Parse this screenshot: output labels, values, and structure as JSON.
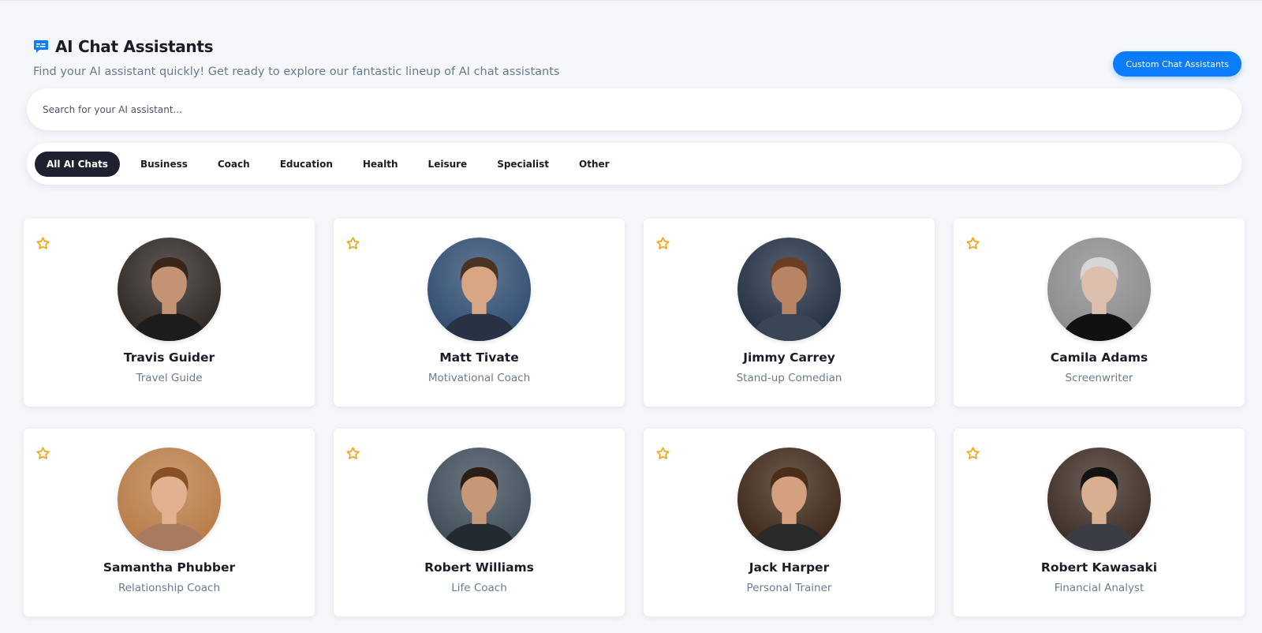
{
  "header": {
    "title": "AI Chat Assistants",
    "subtitle": "Find your AI assistant quickly! Get ready to explore our fantastic lineup of AI chat assistants",
    "icon": "chat-bubble-icon",
    "custom_button_label": "Custom Chat Assistants"
  },
  "search": {
    "placeholder": "Search for your AI assistant..."
  },
  "tabs": [
    {
      "label": "All AI Chats",
      "active": true
    },
    {
      "label": "Business",
      "active": false
    },
    {
      "label": "Coach",
      "active": false
    },
    {
      "label": "Education",
      "active": false
    },
    {
      "label": "Health",
      "active": false
    },
    {
      "label": "Leisure",
      "active": false
    },
    {
      "label": "Specialist",
      "active": false
    },
    {
      "label": "Other",
      "active": false
    }
  ],
  "assistants": [
    {
      "name": "Travis Guider",
      "role": "Travel Guide",
      "favorite": false,
      "bg": "#2a2420",
      "skin": "#c49373",
      "hair": "#3a2618",
      "shirt": "#1c1c1c"
    },
    {
      "name": "Matt Tivate",
      "role": "Motivational Coach",
      "favorite": false,
      "bg": "#2c4a6e",
      "skin": "#d7a684",
      "hair": "#4a3324",
      "shirt": "#283244"
    },
    {
      "name": "Jimmy Carrey",
      "role": "Stand-up Comedian",
      "favorite": false,
      "bg": "#1f2c40",
      "skin": "#b98464",
      "hair": "#6a3e22",
      "shirt": "#3a4656"
    },
    {
      "name": "Camila Adams",
      "role": "Screenwriter",
      "favorite": false,
      "bg": "#8a8a8a",
      "skin": "#dcc0ad",
      "hair": "#d6d6d6",
      "shirt": "#111111"
    },
    {
      "name": "Samantha Phubber",
      "role": "Relationship Coach",
      "favorite": false,
      "bg": "#b77a44",
      "skin": "#e2b190",
      "hair": "#8a4f24",
      "shirt": "#a87a5e"
    },
    {
      "name": "Robert Williams",
      "role": "Life Coach",
      "favorite": false,
      "bg": "#3c4a56",
      "skin": "#c79878",
      "hair": "#2a1e16",
      "shirt": "#232a31"
    },
    {
      "name": "Jack Harper",
      "role": "Personal Trainer",
      "favorite": false,
      "bg": "#3a2414",
      "skin": "#d4a07e",
      "hair": "#4a2e1a",
      "shirt": "#2a2a2a"
    },
    {
      "name": "Robert Kawasaki",
      "role": "Financial Analyst",
      "favorite": false,
      "bg": "#3a2a22",
      "skin": "#d8b090",
      "hair": "#121212",
      "shirt": "#3a3e44"
    }
  ],
  "colors": {
    "accent": "#0a7cff",
    "active_tab": "#1e2130",
    "star": "#f59e0b",
    "muted_text": "#6b7a90"
  }
}
